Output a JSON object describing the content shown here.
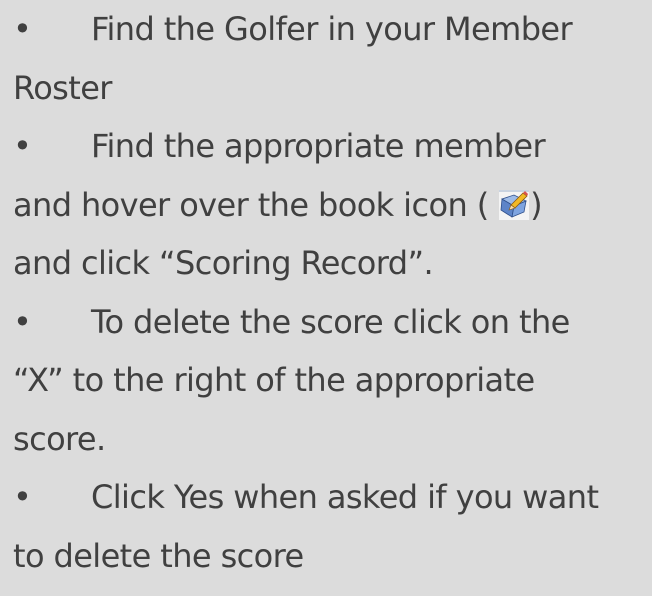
{
  "instructions": {
    "bullet_char": "•",
    "items": [
      {
        "line1": "Find the Golfer in your Member",
        "line2": "Roster"
      },
      {
        "line1": "Find the appropriate member",
        "line2_before": "and hover over the book icon (",
        "line2_after": ")",
        "line3": "and click “Scoring Record”.",
        "icon": "book-icon"
      },
      {
        "line1": "To delete the score click on the",
        "line2": "“X” to the right of the appropriate",
        "line3": "score."
      },
      {
        "line1": "Click Yes when asked if you want",
        "line2": "to delete the score"
      }
    ]
  }
}
